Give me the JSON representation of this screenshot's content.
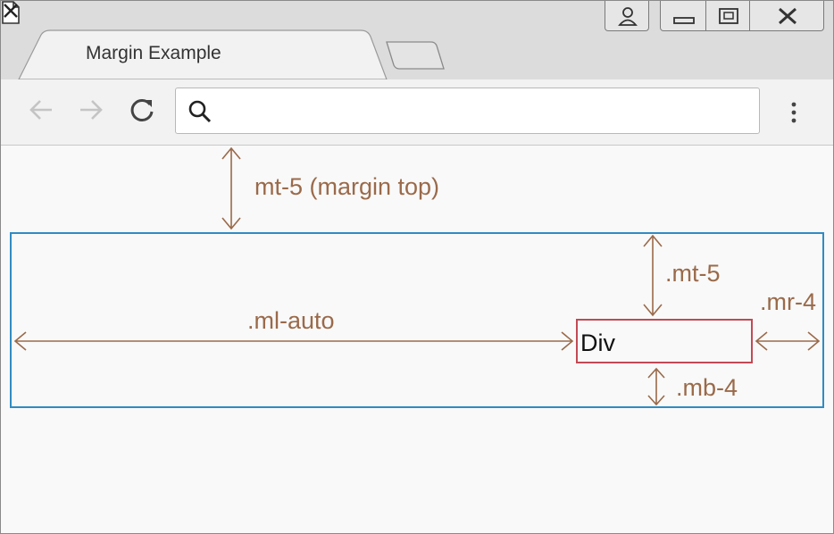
{
  "browser": {
    "tab_title": "Margin Example",
    "icons": [
      "page-icon",
      "close-icon",
      "new-tab",
      "user-icon",
      "minimize-icon",
      "maximize-icon",
      "close-window-icon",
      "back-arrow-icon",
      "forward-arrow-icon",
      "reload-icon",
      "search-icon",
      "more-vert-icon"
    ],
    "address": ""
  },
  "page": {
    "top_label": "mt-5  (margin top)",
    "ml_label": ".ml-auto",
    "mt_label": ".mt-5",
    "mr_label": ".mr-4",
    "mb_label": ".mb-4",
    "div_text": "Div"
  },
  "colors": {
    "annotation": "#9a6a4a",
    "container_border": "#2f8cc2",
    "div_border": "#c24a54"
  }
}
